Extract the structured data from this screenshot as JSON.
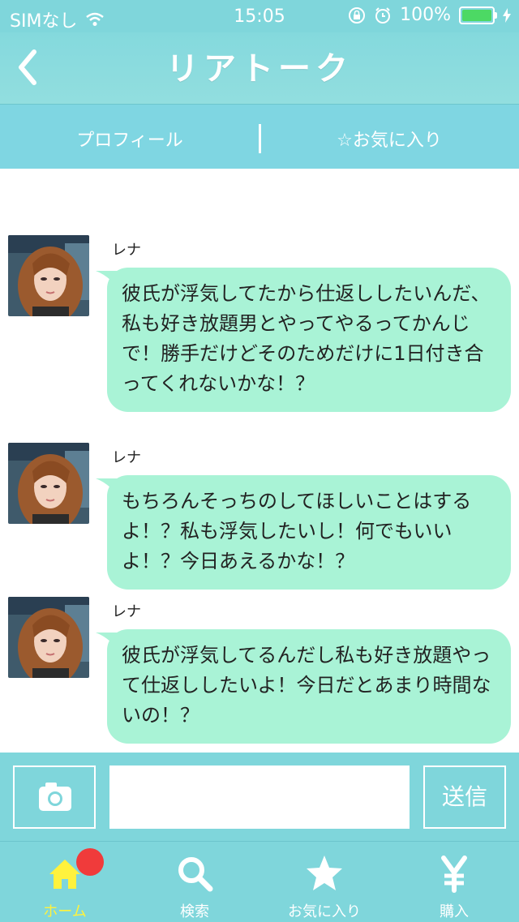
{
  "status_bar": {
    "carrier": "SIMなし",
    "time": "15:05",
    "battery_percent": "100%"
  },
  "header": {
    "title": "リアトーク"
  },
  "subnav": {
    "profile": "プロフィール",
    "favorite": "☆お気に入り"
  },
  "messages": [
    {
      "sender": "レナ",
      "text": "彼氏が浮気してたから仕返ししたいんだ、私も好き放題男とやってやるってかんじで！勝手だけどそのためだけに1日付き合ってくれないかな！？"
    },
    {
      "sender": "レナ",
      "text": "もちろんそっちのしてほしいことはするよ！？私も浮気したいし！何でもいいよ！？今日あえるかな！？"
    },
    {
      "sender": "レナ",
      "text": "彼氏が浮気してるんだし私も好き放題やって仕返ししたいよ！今日だとあまり時間ないの！？"
    }
  ],
  "composer": {
    "send_label": "送信"
  },
  "tabbar": {
    "items": [
      {
        "label": "ホーム",
        "icon": "home-icon",
        "active": true
      },
      {
        "label": "検索",
        "icon": "search-icon",
        "active": false
      },
      {
        "label": "お気に入り",
        "icon": "star-icon",
        "active": false
      },
      {
        "label": "購入",
        "icon": "yen-icon",
        "active": false
      }
    ]
  },
  "colors": {
    "header": "#7fd6db",
    "bubble": "#a9f3d6",
    "active_tab": "#fff23d",
    "badge": "#f03b3b"
  }
}
